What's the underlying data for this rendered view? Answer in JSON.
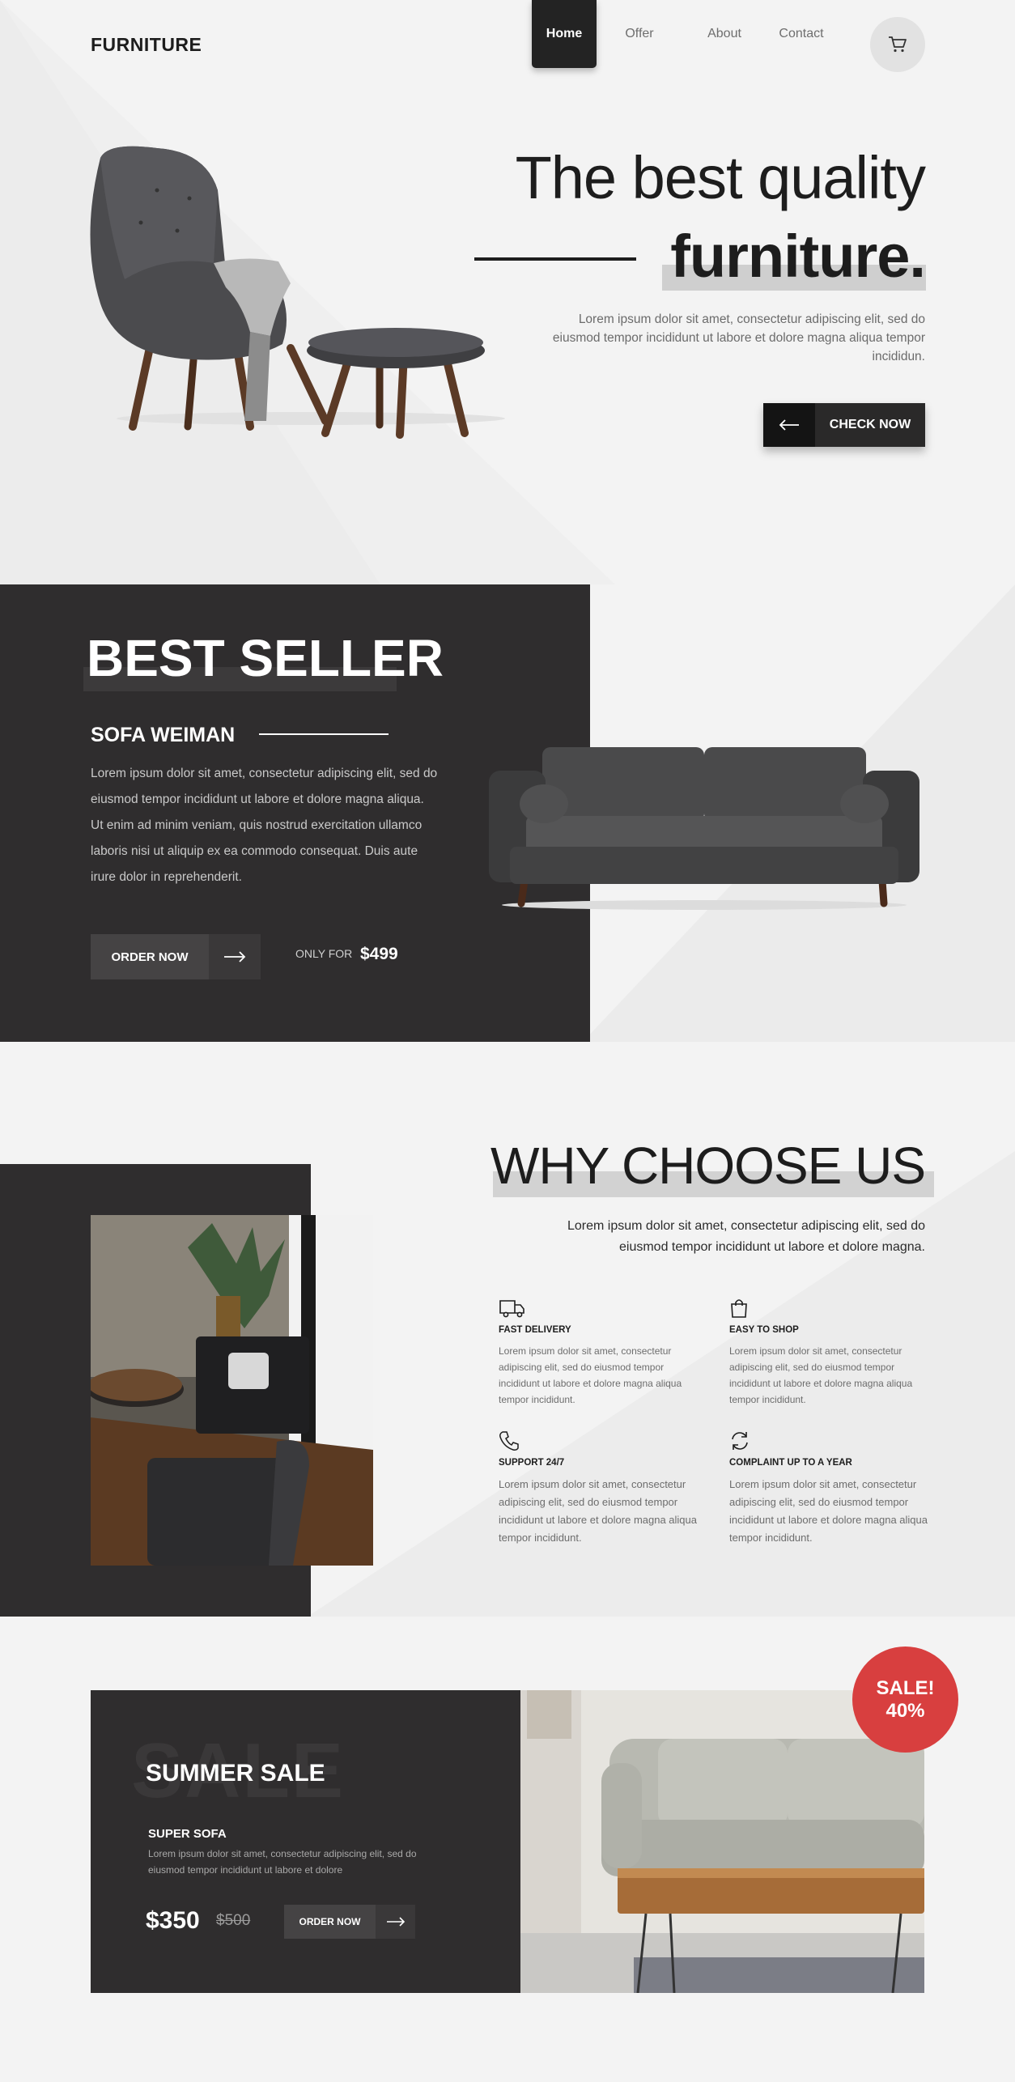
{
  "header": {
    "logo": "FURNITURE",
    "nav": [
      {
        "label": "Home",
        "active": true
      },
      {
        "label": "Offer",
        "active": false
      },
      {
        "label": "About",
        "active": false
      },
      {
        "label": "Contact",
        "active": false
      }
    ],
    "cart_icon": "cart-icon"
  },
  "hero": {
    "title_line1": "The best quality",
    "title_line2": "furniture.",
    "description": "Lorem ipsum dolor sit amet, consectetur adipiscing elit, sed do eiusmod tempor incididunt ut labore et dolore magna aliqua tempor incididun.",
    "cta_label": "CHECK NOW",
    "cta_icon": "arrow-left-icon"
  },
  "best_seller": {
    "title": "BEST SELLER",
    "product_name": "SOFA WEIMAN",
    "description": "Lorem ipsum dolor sit amet, consectetur adipiscing elit, sed do eiusmod tempor incididunt ut labore et dolore magna aliqua. Ut enim ad minim veniam, quis nostrud exercitation ullamco laboris nisi ut aliquip ex ea commodo consequat. Duis aute irure dolor in reprehenderit.",
    "order_label": "ORDER NOW",
    "order_icon": "arrow-right-icon",
    "price_prefix": "ONLY FOR",
    "price": "$499"
  },
  "why": {
    "title": "WHY CHOOSE US",
    "description": "Lorem ipsum dolor sit amet, consectetur adipiscing elit, sed do eiusmod tempor incididunt ut labore et dolore magna.",
    "features": [
      {
        "icon": "truck-icon",
        "title": "FAST DELIVERY",
        "text": "Lorem ipsum dolor sit amet, consectetur adipiscing elit, sed do eiusmod tempor incididunt ut labore et dolore magna aliqua tempor incididunt."
      },
      {
        "icon": "shopping-bag-icon",
        "title": "EASY TO SHOP",
        "text": "Lorem ipsum dolor sit amet, consectetur adipiscing elit, sed do eiusmod tempor incididunt ut labore et dolore magna aliqua tempor incididunt."
      },
      {
        "icon": "phone-icon",
        "title": "SUPPORT 24/7",
        "text": "Lorem ipsum dolor sit amet, consectetur adipiscing elit, sed do eiusmod tempor incididunt ut labore et dolore magna aliqua tempor incididunt."
      },
      {
        "icon": "refresh-icon",
        "title": "COMPLAINT UP TO A YEAR",
        "text": "Lorem ipsum dolor sit amet, consectetur adipiscing elit, sed do eiusmod tempor incididunt ut labore et dolore magna aliqua tempor incididunt."
      }
    ]
  },
  "sale": {
    "background_word": "SALE",
    "title": "SUMMER SALE",
    "product_name": "SUPER SOFA",
    "description": "Lorem ipsum dolor sit amet, consectetur adipiscing elit, sed do eiusmod tempor incididunt ut labore et dolore",
    "price": "$350",
    "old_price": "$500",
    "order_label": "ORDER NOW",
    "order_icon": "arrow-right-icon",
    "badge_line1": "SALE!",
    "badge_line2": "40%"
  },
  "colors": {
    "dark": "#2f2d2e",
    "text": "#1d1d1d",
    "accent_red": "#d83f3f",
    "background": "#f3f3f3"
  }
}
